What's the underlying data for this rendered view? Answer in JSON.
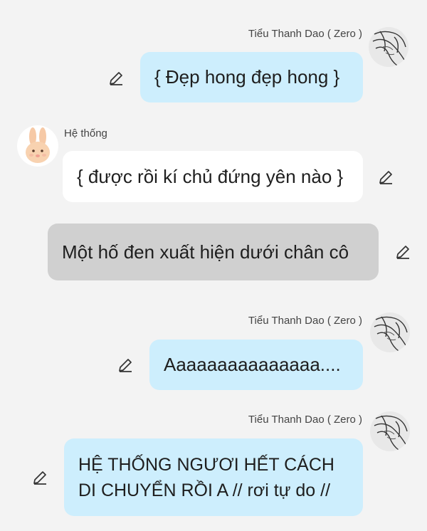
{
  "messages": [
    {
      "sender": "Tiểu Thanh Dao ( Zero )",
      "avatar_icon": "sketch-girl-avatar-icon",
      "text": "{ Đẹp hong đẹp hong }",
      "style": "blue",
      "side": "right"
    },
    {
      "sender": "Hệ thống",
      "avatar_icon": "bunny-avatar-icon",
      "text": "{ được rồi kí chủ đứng yên nào }",
      "style": "white",
      "side": "left"
    },
    {
      "sender": "",
      "text": "Một hố đen xuất hiện dưới chân cô",
      "style": "gray",
      "side": "narration"
    },
    {
      "sender": "Tiểu Thanh Dao ( Zero )",
      "avatar_icon": "sketch-girl-avatar-icon",
      "text": "Aaaaaaaaaaaaaaa....",
      "style": "blue",
      "side": "right"
    },
    {
      "sender": "Tiểu Thanh Dao ( Zero )",
      "avatar_icon": "sketch-girl-avatar-icon",
      "text_line1": "HỆ THỐNG NGƯƠI HẾT CÁCH",
      "text_line2": "DI CHUYỂN RỒI A // rơi tự do //",
      "style": "blue",
      "side": "right"
    }
  ],
  "icons": {
    "edit": "pencil-edit-icon"
  },
  "colors": {
    "background": "#f3f3f3",
    "blue_bubble": "#cdeefd",
    "white_bubble": "#ffffff",
    "gray_bubble": "#d0d0d0"
  }
}
